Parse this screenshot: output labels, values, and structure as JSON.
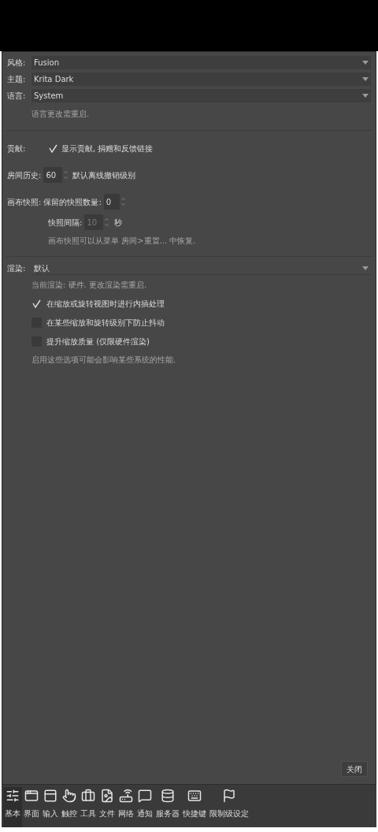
{
  "dropdowns": [
    {
      "label": "风格:",
      "value": "Fusion"
    },
    {
      "label": "主题:",
      "value": "Krita Dark"
    },
    {
      "label": "语言:",
      "value": "System"
    }
  ],
  "language_note": "语言更改需重启.",
  "contribution": {
    "label": "贡献:",
    "checkbox": {
      "label": "显示贡献, 捐赠和反馈链接",
      "checked": true
    }
  },
  "room_history": {
    "label": "房间历史:",
    "value": "60",
    "suffix": "默认离线撤销级别"
  },
  "canvas_snapshots": {
    "label": "画布快照:",
    "count_label": "保留的快照数量:",
    "count_value": "0",
    "interval_label": "快照间隔:",
    "interval_value": "10",
    "interval_disabled": true,
    "interval_unit": "秒",
    "note": "画布快照可以从菜单 房间>重置... 中恢复."
  },
  "rendering": {
    "label": "渲染:",
    "value": "默认",
    "note": "当前渲染: 硬件. 更改渲染需重启.",
    "options": [
      {
        "label": "在缩放或旋转视图时进行内插处理",
        "checked": true
      },
      {
        "label": "在某些缩放和旋转级别下防止抖动",
        "checked": false
      },
      {
        "label": "提升缩放质量 (仅限硬件渲染)",
        "checked": false
      }
    ],
    "footnote": "启用这些选项可能会影响某些系统的性能."
  },
  "close_button": "关闭",
  "tabs": [
    {
      "label": "基本",
      "selected": true
    },
    {
      "label": "界面",
      "selected": false
    },
    {
      "label": "输入",
      "selected": false
    },
    {
      "label": "触控",
      "selected": false
    },
    {
      "label": "工具",
      "selected": false
    },
    {
      "label": "文件",
      "selected": false
    },
    {
      "label": "网络",
      "selected": false
    },
    {
      "label": "通知",
      "selected": false
    },
    {
      "label": "服务器",
      "selected": false
    },
    {
      "label": "快捷键",
      "selected": false
    },
    {
      "label": "限制级设定",
      "selected": false
    }
  ]
}
